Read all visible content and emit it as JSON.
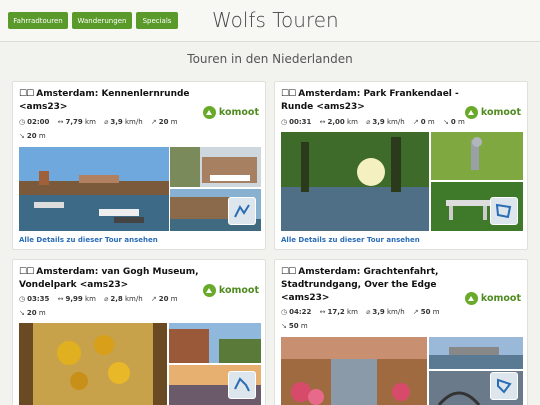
{
  "nav": {
    "buttons": [
      "Fahrradtouren",
      "Wanderungen",
      "Specials"
    ],
    "color": "#5a9a2a"
  },
  "site_title": "Wolfs Touren",
  "section_title": "Touren in den Niederlanden",
  "brand": "komoot",
  "details_label": "Alle Details zu dieser Tour ansehen",
  "cards": [
    {
      "checks": "☐☐",
      "title": "Amsterdam: Kennenlernrunde <ams23>",
      "duration": "02:00",
      "distance": "7,79",
      "distance_unit": "km",
      "speed": "3,9",
      "speed_unit": "km/h",
      "up": "20",
      "up_unit": "m",
      "down": "20",
      "down_unit": "m"
    },
    {
      "checks": "☐☐",
      "title": "Amsterdam: Park Frankendael - Runde <ams23>",
      "duration": "00:31",
      "distance": "2,00",
      "distance_unit": "km",
      "speed": "3,9",
      "speed_unit": "km/h",
      "up": "0",
      "up_unit": "m",
      "down": "0",
      "down_unit": "m"
    },
    {
      "checks": "☐☐",
      "title": "Amsterdam: van Gogh Museum, Vondelpark <ams23>",
      "duration": "03:35",
      "distance": "9,99",
      "distance_unit": "km",
      "speed": "2,8",
      "speed_unit": "km/h",
      "up": "20",
      "up_unit": "m",
      "down": "20",
      "down_unit": "m"
    },
    {
      "checks": "☐☐",
      "title": "Amsterdam: Grachtenfahrt, Stadtrundgang, Over the Edge <ams23>",
      "duration": "04:22",
      "distance": "17,2",
      "distance_unit": "km",
      "speed": "3,9",
      "speed_unit": "km/h",
      "up": "50",
      "up_unit": "m",
      "down": "50",
      "down_unit": "m"
    }
  ]
}
